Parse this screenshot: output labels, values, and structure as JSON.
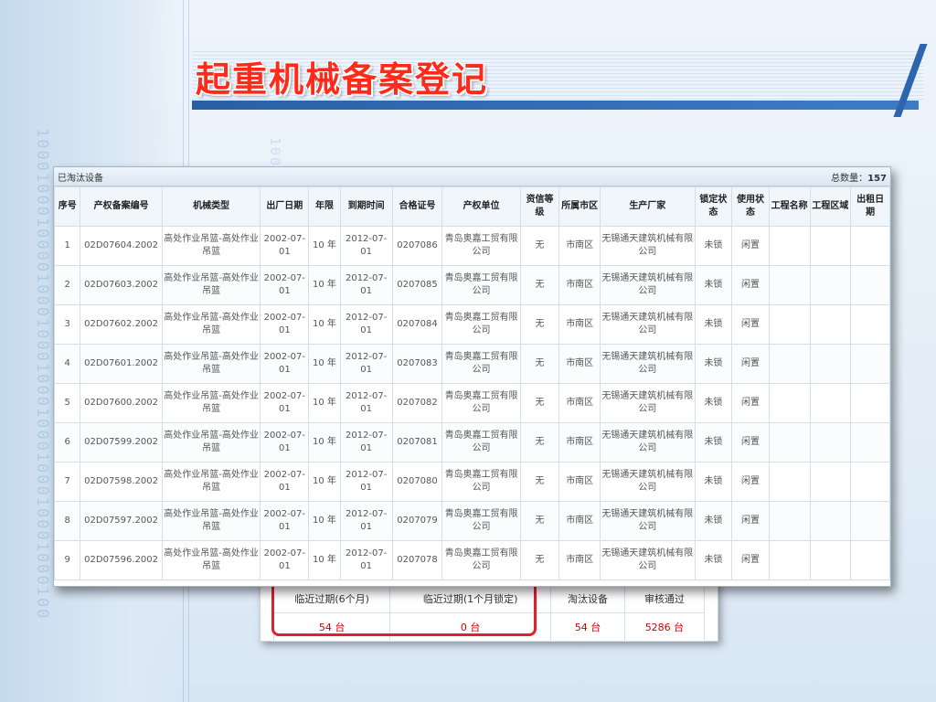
{
  "page_title": "起重机械备案登记",
  "panel": {
    "caption": "已淘汰设备",
    "total_label": "总数量：",
    "total_value": "157"
  },
  "table": {
    "headers": [
      "序号",
      "产权备案编号",
      "机械类型",
      "出厂日期",
      "年限",
      "到期时间",
      "合格证号",
      "产权单位",
      "资信等级",
      "所属市区",
      "生产厂家",
      "锁定状态",
      "使用状态",
      "工程名称",
      "工程区域",
      "出租日期"
    ],
    "rows": [
      [
        "1",
        "02D07604.2002",
        "高处作业吊篮-高处作业吊篮",
        "2002-07-01",
        "10 年",
        "2012-07-01",
        "0207086",
        "青岛奥嘉工贸有限公司",
        "无",
        "市南区",
        "无锡通天建筑机械有限公司",
        "未锁",
        "闲置",
        "",
        "",
        ""
      ],
      [
        "2",
        "02D07603.2002",
        "高处作业吊篮-高处作业吊篮",
        "2002-07-01",
        "10 年",
        "2012-07-01",
        "0207085",
        "青岛奥嘉工贸有限公司",
        "无",
        "市南区",
        "无锡通天建筑机械有限公司",
        "未锁",
        "闲置",
        "",
        "",
        ""
      ],
      [
        "3",
        "02D07602.2002",
        "高处作业吊篮-高处作业吊篮",
        "2002-07-01",
        "10 年",
        "2012-07-01",
        "0207084",
        "青岛奥嘉工贸有限公司",
        "无",
        "市南区",
        "无锡通天建筑机械有限公司",
        "未锁",
        "闲置",
        "",
        "",
        ""
      ],
      [
        "4",
        "02D07601.2002",
        "高处作业吊篮-高处作业吊篮",
        "2002-07-01",
        "10 年",
        "2012-07-01",
        "0207083",
        "青岛奥嘉工贸有限公司",
        "无",
        "市南区",
        "无锡通天建筑机械有限公司",
        "未锁",
        "闲置",
        "",
        "",
        ""
      ],
      [
        "5",
        "02D07600.2002",
        "高处作业吊篮-高处作业吊篮",
        "2002-07-01",
        "10 年",
        "2012-07-01",
        "0207082",
        "青岛奥嘉工贸有限公司",
        "无",
        "市南区",
        "无锡通天建筑机械有限公司",
        "未锁",
        "闲置",
        "",
        "",
        ""
      ],
      [
        "6",
        "02D07599.2002",
        "高处作业吊篮-高处作业吊篮",
        "2002-07-01",
        "10 年",
        "2012-07-01",
        "0207081",
        "青岛奥嘉工贸有限公司",
        "无",
        "市南区",
        "无锡通天建筑机械有限公司",
        "未锁",
        "闲置",
        "",
        "",
        ""
      ],
      [
        "7",
        "02D07598.2002",
        "高处作业吊篮-高处作业吊篮",
        "2002-07-01",
        "10 年",
        "2012-07-01",
        "0207080",
        "青岛奥嘉工贸有限公司",
        "无",
        "市南区",
        "无锡通天建筑机械有限公司",
        "未锁",
        "闲置",
        "",
        "",
        ""
      ],
      [
        "8",
        "02D07597.2002",
        "高处作业吊篮-高处作业吊篮",
        "2002-07-01",
        "10 年",
        "2012-07-01",
        "0207079",
        "青岛奥嘉工贸有限公司",
        "无",
        "市南区",
        "无锡通天建筑机械有限公司",
        "未锁",
        "闲置",
        "",
        "",
        ""
      ],
      [
        "9",
        "02D07596.2002",
        "高处作业吊篮-高处作业吊篮",
        "2002-07-01",
        "10 年",
        "2012-07-01",
        "0207078",
        "青岛奥嘉工贸有限公司",
        "无",
        "市南区",
        "无锡通天建筑机械有限公司",
        "未锁",
        "闲置",
        "",
        "",
        ""
      ]
    ]
  },
  "summary": {
    "labels": [
      "临近过期(6个月)",
      "临近过期(1个月锁定)",
      "淘汰设备",
      "审核通过"
    ],
    "values": [
      "54 台",
      "0 台",
      "54 台",
      "5286 台"
    ]
  },
  "background": {
    "binary_left": "10001000100001000100010001000100010001000100",
    "binary_right": "10001"
  },
  "colors": {
    "title_red": "#ff2a1a",
    "banner_blue": "#2a5fa5",
    "summary_value_red": "#d00000",
    "highlight_red": "#e0202a"
  }
}
